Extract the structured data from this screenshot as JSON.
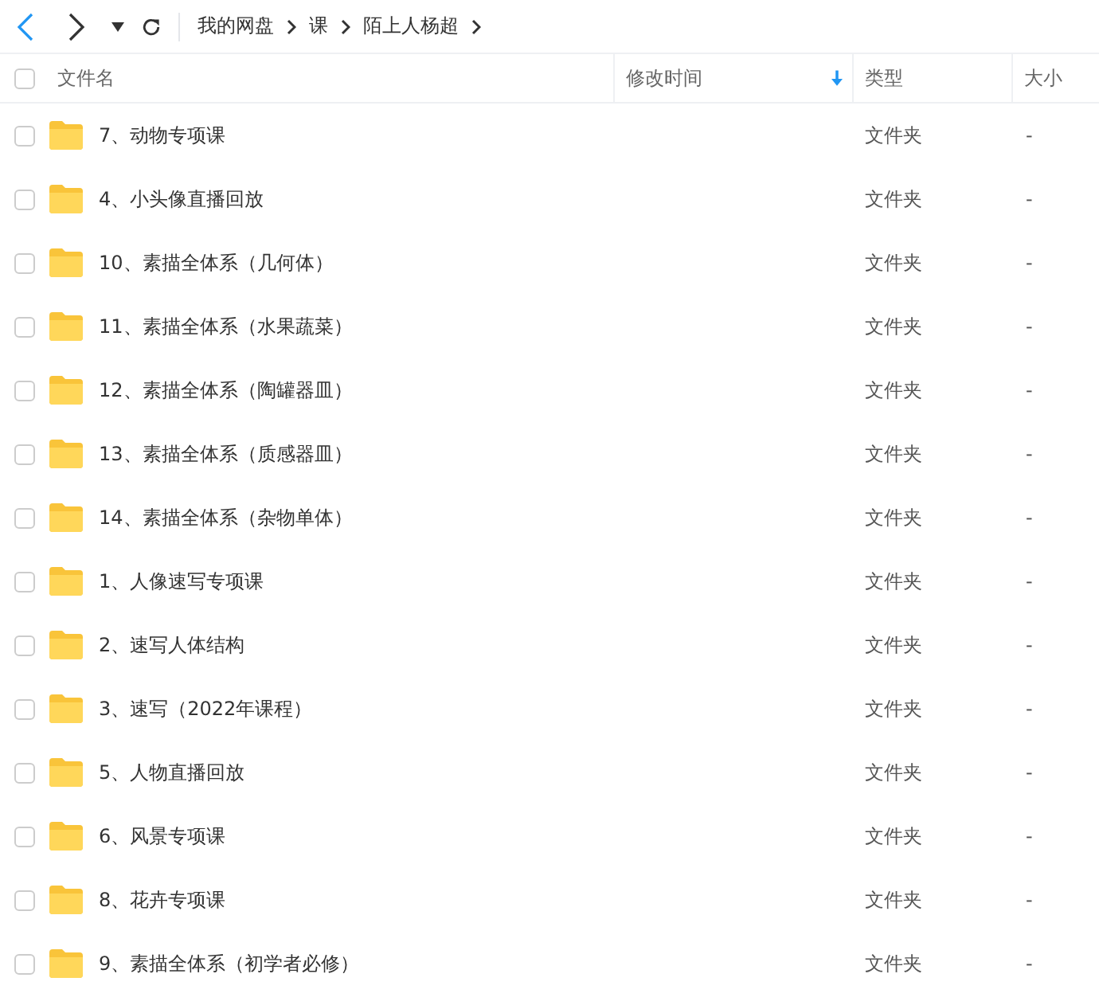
{
  "toolbar": {
    "back_enabled": true,
    "forward_enabled": true
  },
  "breadcrumb": [
    "我的网盘",
    "课",
    "陌上人杨超"
  ],
  "table": {
    "all_checked": false,
    "columns": [
      {
        "label": "文件名",
        "sorted": false
      },
      {
        "label": "修改时间",
        "sorted": true
      },
      {
        "label": "类型",
        "sorted": false
      },
      {
        "label": "大小",
        "sorted": false
      }
    ],
    "rows": [
      {
        "name": "7、动物专项课",
        "type": "文件夹",
        "size": "-",
        "checked": false
      },
      {
        "name": "4、小头像直播回放",
        "type": "文件夹",
        "size": "-",
        "checked": false
      },
      {
        "name": "10、素描全体系（几何体）",
        "type": "文件夹",
        "size": "-",
        "checked": false
      },
      {
        "name": "11、素描全体系（水果蔬菜）",
        "type": "文件夹",
        "size": "-",
        "checked": false
      },
      {
        "name": "12、素描全体系（陶罐器皿）",
        "type": "文件夹",
        "size": "-",
        "checked": false
      },
      {
        "name": "13、素描全体系（质感器皿）",
        "type": "文件夹",
        "size": "-",
        "checked": false
      },
      {
        "name": "14、素描全体系（杂物单体）",
        "type": "文件夹",
        "size": "-",
        "checked": false
      },
      {
        "name": "1、人像速写专项课",
        "type": "文件夹",
        "size": "-",
        "checked": false
      },
      {
        "name": "2、速写人体结构",
        "type": "文件夹",
        "size": "-",
        "checked": false
      },
      {
        "name": "3、速写（2022年课程）",
        "type": "文件夹",
        "size": "-",
        "checked": false
      },
      {
        "name": "5、人物直播回放",
        "type": "文件夹",
        "size": "-",
        "checked": false
      },
      {
        "name": "6、风景专项课",
        "type": "文件夹",
        "size": "-",
        "checked": false
      },
      {
        "name": "8、花卉专项课",
        "type": "文件夹",
        "size": "-",
        "checked": false
      },
      {
        "name": "9、素描全体系（初学者必修）",
        "type": "文件夹",
        "size": "-",
        "checked": false
      }
    ]
  }
}
